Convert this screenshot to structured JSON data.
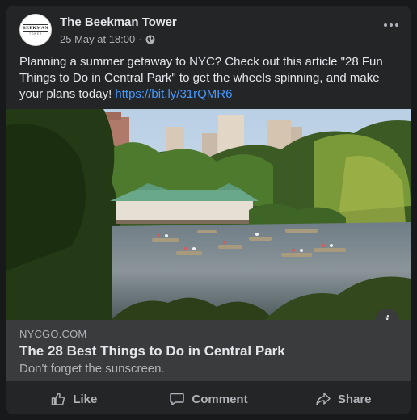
{
  "post": {
    "page_name": "The Beekman Tower",
    "timestamp": "25 May at 18:00",
    "separator": "·",
    "privacy_icon": "globe-icon",
    "text": "Planning a summer getaway to NYC? Check out this article \"28 Fun Things to Do in Central Park\" to get the wheels spinning, and make your plans today! ",
    "link_text": "https://bit.ly/31rQMR6",
    "avatar_logo": {
      "name": "BEEKMAN",
      "sub": "TOWER"
    }
  },
  "link_preview": {
    "domain": "NYCGO.COM",
    "title": "The 28 Best Things to Do in Central Park",
    "description": "Don't forget the sunscreen."
  },
  "actions": {
    "like": "Like",
    "comment": "Comment",
    "share": "Share"
  },
  "colors": {
    "background": "#18191a",
    "card": "#242526",
    "link_box": "#3a3b3c",
    "text_primary": "#e4e6eb",
    "text_secondary": "#b0b3b8",
    "link": "#4599ff"
  }
}
